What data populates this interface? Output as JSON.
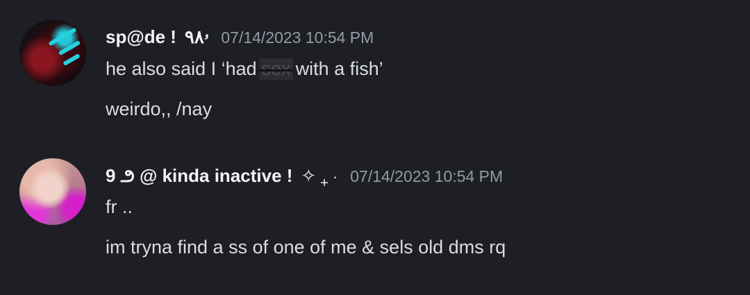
{
  "messages": [
    {
      "username": "sp@de !",
      "username_deco": "ۥ٩٨",
      "timestamp": "07/14/2023 10:54 PM",
      "lines": [
        "he also said I ‘had",
        "sex",
        "with a fish’",
        "weirdo,, /nay"
      ]
    },
    {
      "username": "9 ౨ @ kinda inactive !",
      "sparkle": "✧",
      "plus": "+",
      "dot": "·",
      "timestamp": "07/14/2023 10:54 PM",
      "lines": [
        "fr ..",
        "im tryna find a ss of one of me & sels old dms rq"
      ]
    }
  ]
}
